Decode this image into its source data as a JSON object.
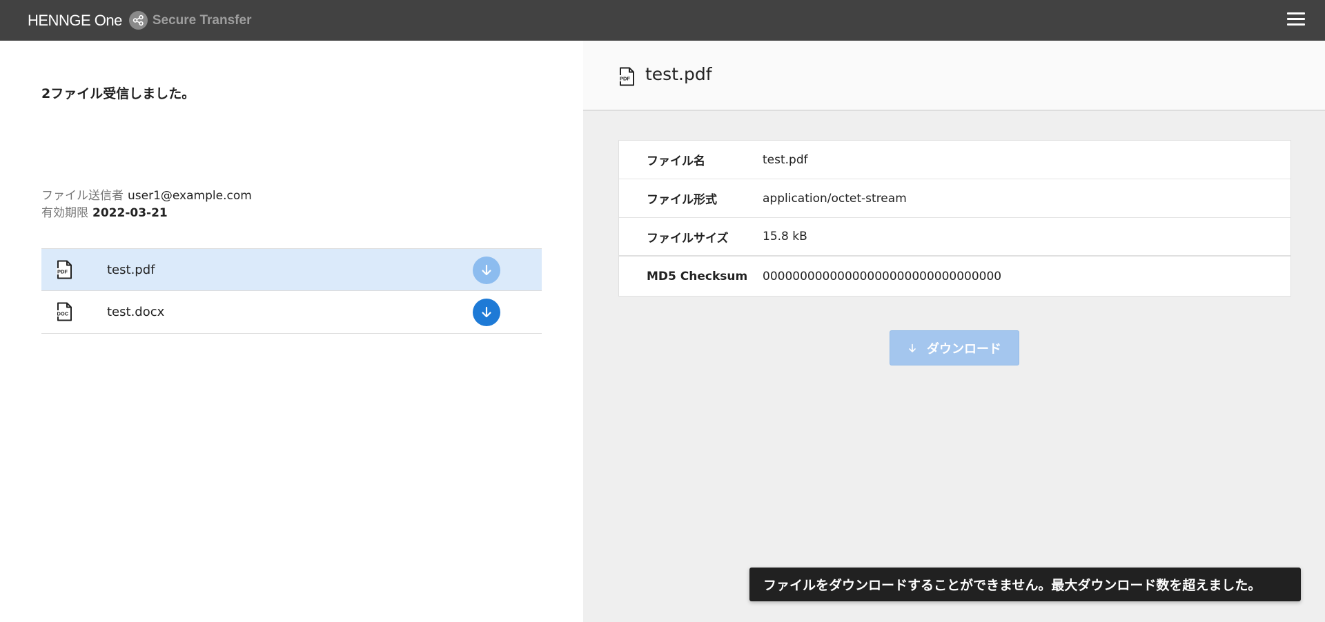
{
  "header": {
    "brand": "HENNGE One",
    "product": "Secure Transfer"
  },
  "left": {
    "received_text": "2ファイル受信しました。",
    "sender_label": "ファイル送信者",
    "sender_value": "user1@example.com",
    "expiry_label": "有効期限",
    "expiry_value": "2022-03-21",
    "files": [
      {
        "name": "test.pdf",
        "icon": "pdf-file-icon",
        "selected": true
      },
      {
        "name": "test.docx",
        "icon": "doc-file-icon",
        "selected": false
      }
    ]
  },
  "right": {
    "title": "test.pdf",
    "details": [
      {
        "key": "ファイル名",
        "value": "test.pdf"
      },
      {
        "key": "ファイル形式",
        "value": "application/octet-stream"
      },
      {
        "key": "ファイルサイズ",
        "value": "15.8 kB"
      },
      {
        "key": "MD5 Checksum",
        "value": "00000000000000000000000000000000"
      }
    ],
    "download_label": "ダウンロード"
  },
  "toast": {
    "message": "ファイルをダウンロードすることができません。最大ダウンロード数を超えました。"
  },
  "colors": {
    "topbar": "#424242",
    "accent": "#1e7ad6",
    "accent_faded": "#8cbcef",
    "selected_row": "#dbeafa",
    "toast_bg": "#212121"
  }
}
